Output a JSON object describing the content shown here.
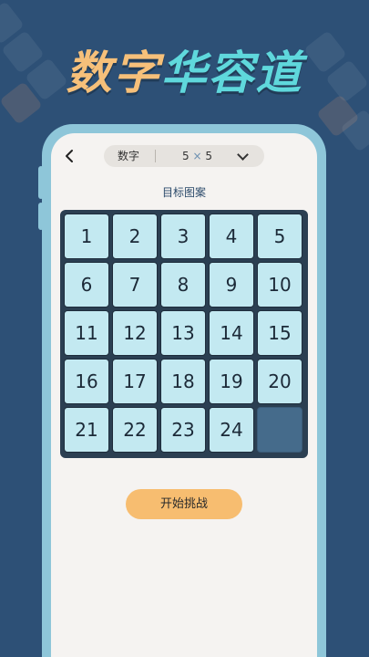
{
  "header": {
    "title_part1": "数字",
    "title_part2": "华容道",
    "title_color1": "#f6c07a",
    "title_color2": "#5fd8dc"
  },
  "toolbar": {
    "back_icon": "chevron-left-icon",
    "mode_label": "数字",
    "size_value": "5",
    "size_separator": "×",
    "size_value2": "5",
    "dropdown_icon": "chevron-down-icon"
  },
  "puzzle": {
    "subtitle": "目标图案",
    "rows": 5,
    "cols": 5,
    "tiles": [
      "1",
      "2",
      "3",
      "4",
      "5",
      "6",
      "7",
      "8",
      "9",
      "10",
      "11",
      "12",
      "13",
      "14",
      "15",
      "16",
      "17",
      "18",
      "19",
      "20",
      "21",
      "22",
      "23",
      "24",
      ""
    ],
    "tile_color": "#c3e9f1",
    "empty_color": "#456b8b"
  },
  "actions": {
    "start_label": "开始挑战",
    "start_color": "#f7bd70"
  }
}
